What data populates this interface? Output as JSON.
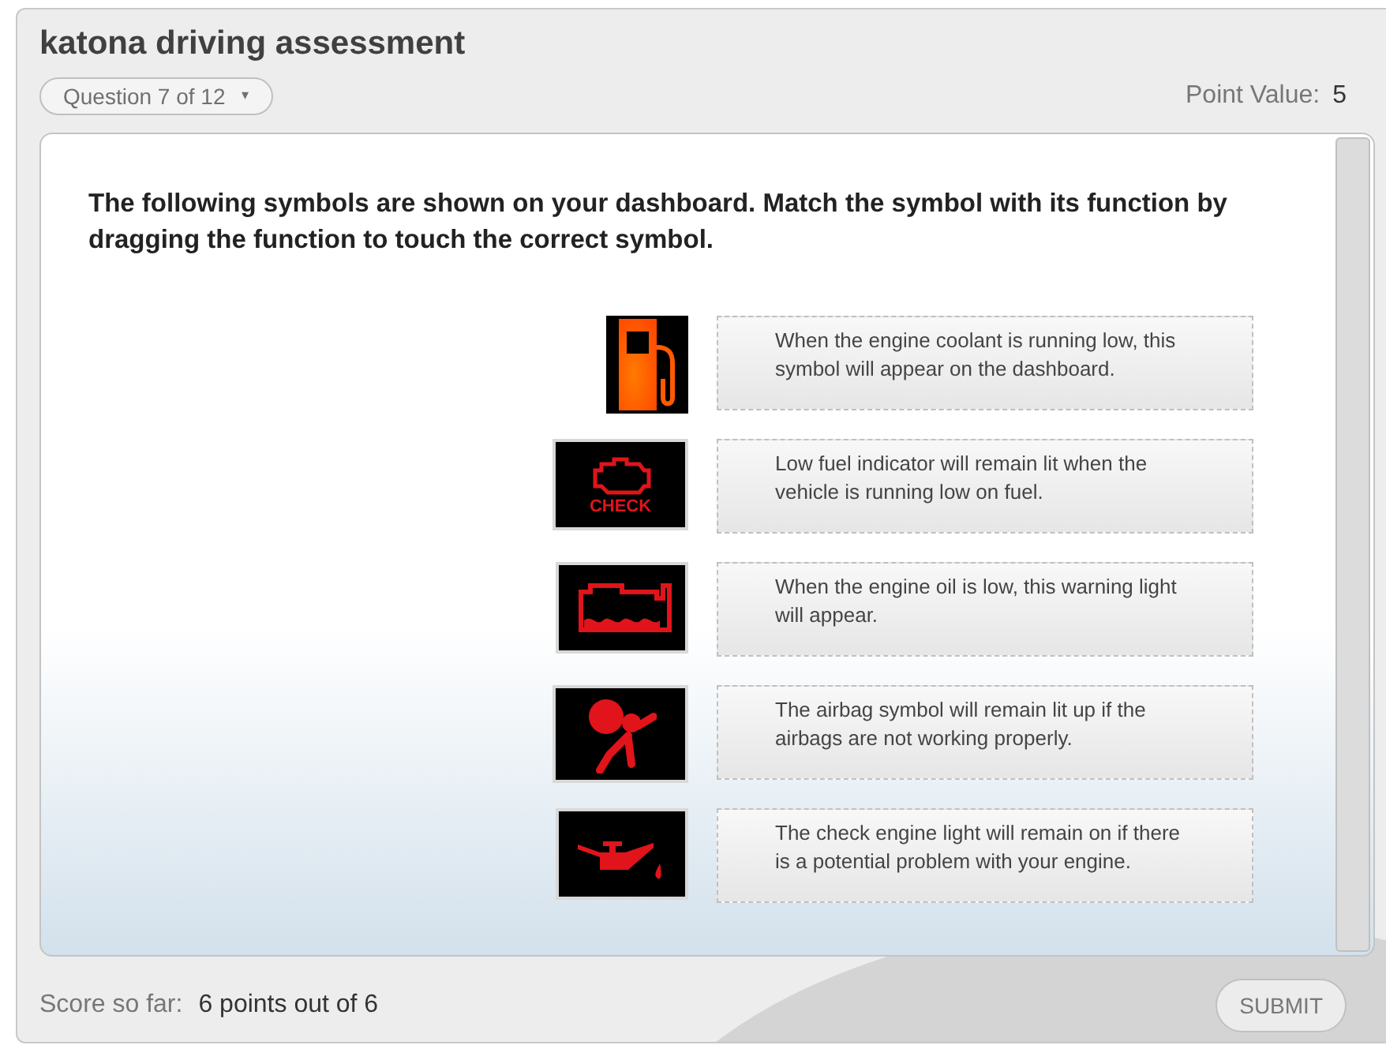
{
  "window": {
    "title": "katona driving assessment"
  },
  "question_selector": {
    "label": "Question 7 of 12",
    "caret": "▾"
  },
  "point_value": {
    "label": "Point Value:",
    "value": "5"
  },
  "prompt": "The following symbols are shown on your dashboard. Match the symbol with its function by dragging the function to touch the correct symbol.",
  "symbols": [
    {
      "kind": "fuel"
    },
    {
      "kind": "check-engine",
      "label": "CHECK"
    },
    {
      "kind": "coolant"
    },
    {
      "kind": "airbag"
    },
    {
      "kind": "oil"
    }
  ],
  "functions": [
    {
      "text": "When the engine coolant is running low, this symbol will appear on the dashboard."
    },
    {
      "text": "Low fuel indicator will remain lit when the vehicle is running low on fuel."
    },
    {
      "text": "When the engine oil is low, this warning light will appear."
    },
    {
      "text": "The airbag symbol will remain lit up if the airbags are not working properly."
    },
    {
      "text": "The check engine light will remain on if there is a potential problem with your engine."
    }
  ],
  "score": {
    "label": "Score so far:",
    "value": "6 points out of 6"
  },
  "buttons": [
    {
      "label": "SUBMIT"
    }
  ]
}
